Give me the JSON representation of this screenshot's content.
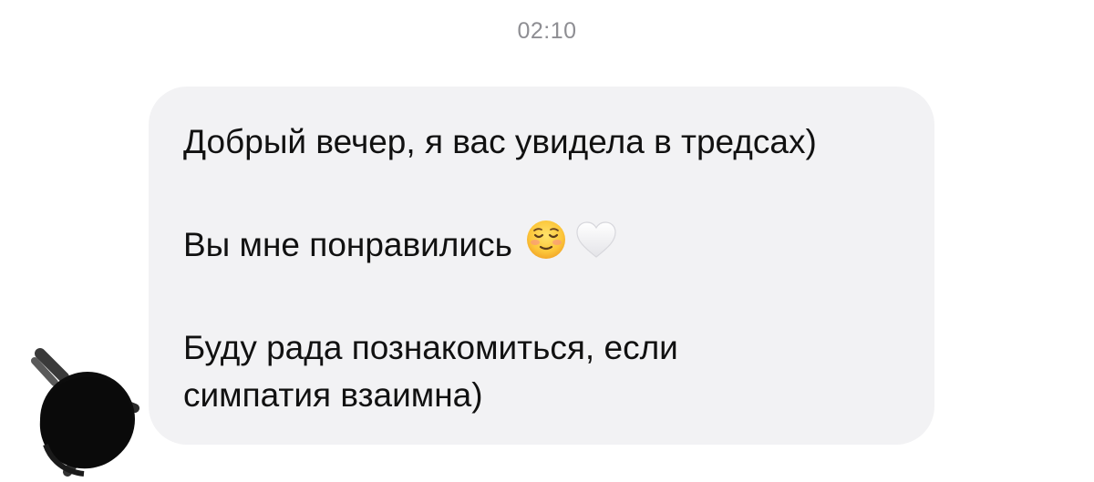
{
  "chat": {
    "timestamp": "02:10",
    "message": {
      "line1": "Добрый вечер, я вас увидела в тредсах)",
      "line2": "Вы мне понравились",
      "line3": "Буду рада познакомиться, если",
      "line4": "симпатия взаимна)",
      "emojis": [
        "relieved-face-icon",
        "white-heart-icon"
      ]
    },
    "sender_avatar": "redacted-avatar"
  },
  "colors": {
    "bubble": "#f2f2f4",
    "text": "#111111",
    "timestamp": "#8e8e93",
    "redaction": "#0c0c0c"
  }
}
